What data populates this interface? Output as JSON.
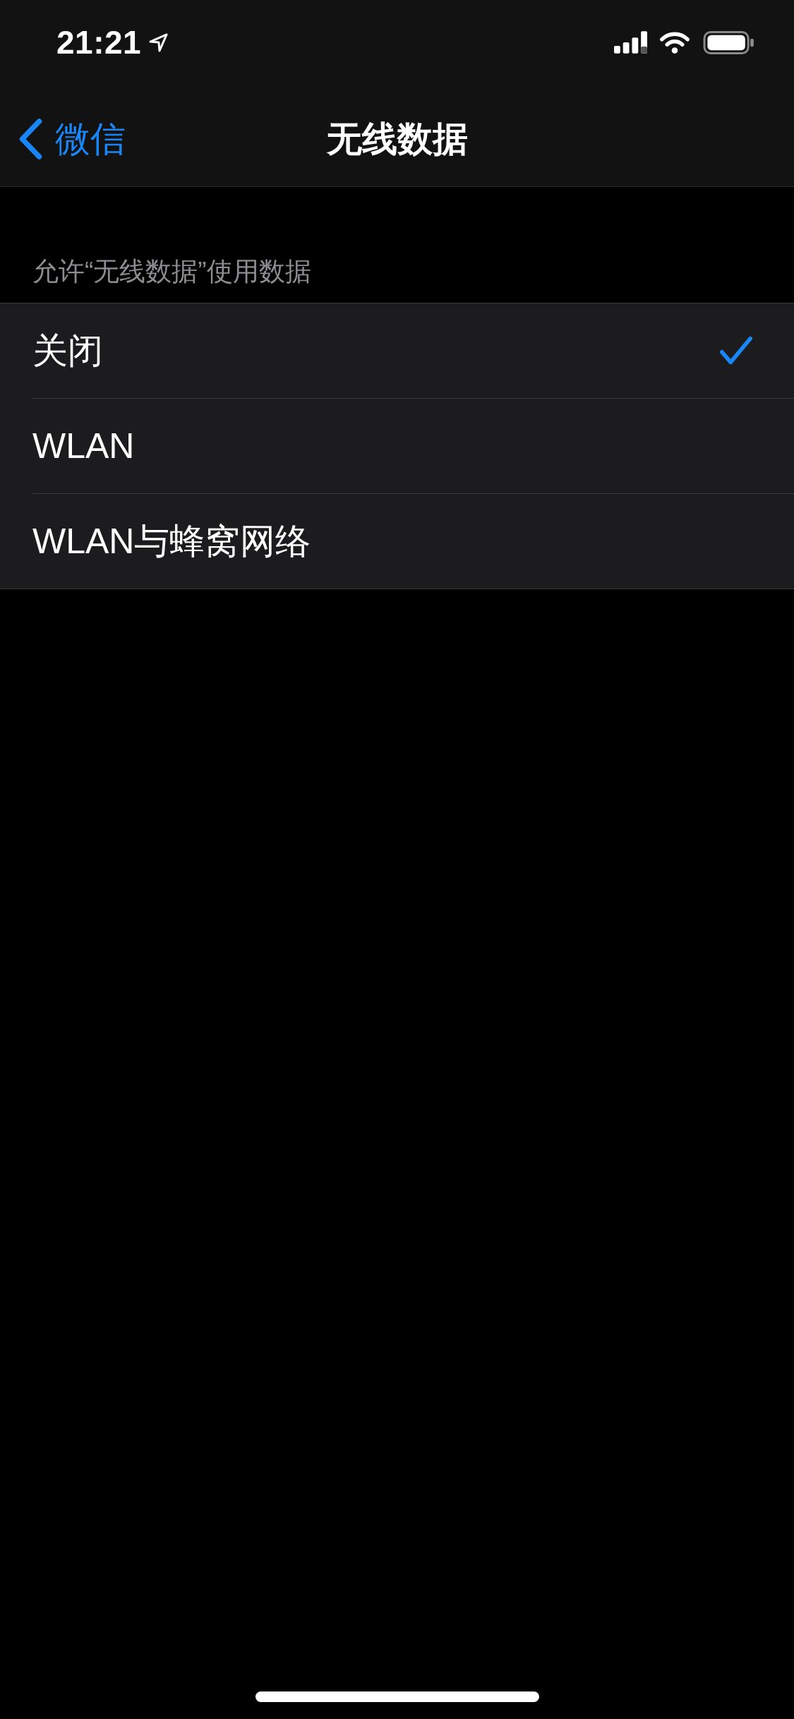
{
  "status_bar": {
    "time": "21:21"
  },
  "nav_bar": {
    "back_label": "微信",
    "title": "无线数据"
  },
  "section": {
    "header": "允许“无线数据”使用数据",
    "options": [
      {
        "label": "关闭",
        "selected": true
      },
      {
        "label": "WLAN",
        "selected": false
      },
      {
        "label": "WLAN与蜂窝网络",
        "selected": false
      }
    ]
  }
}
